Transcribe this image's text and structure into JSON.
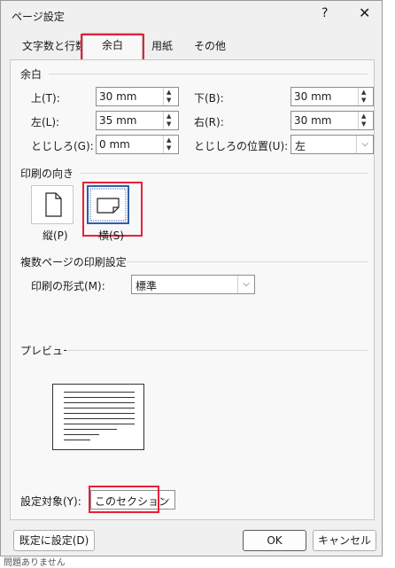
{
  "window": {
    "title": "ページ設定",
    "help": "?",
    "close": "✕"
  },
  "tabs": [
    {
      "label": "文字数と行数"
    },
    {
      "label": "余白"
    },
    {
      "label": "用紙"
    },
    {
      "label": "その他"
    }
  ],
  "margins": {
    "heading": "余白",
    "top_label": "上(T):",
    "top_value": "30 mm",
    "bottom_label": "下(B):",
    "bottom_value": "30 mm",
    "left_label": "左(L):",
    "left_value": "35 mm",
    "right_label": "右(R):",
    "right_value": "30 mm",
    "gutter_label": "とじしろ(G):",
    "gutter_value": "0 mm",
    "gutter_pos_label": "とじしろの位置(U):",
    "gutter_pos_value": "左"
  },
  "orientation": {
    "heading": "印刷の向き",
    "portrait_label": "縦(P)",
    "landscape_label": "横(S)",
    "selected": "横(S)"
  },
  "pages": {
    "heading": "複数ページの印刷設定",
    "format_label": "印刷の形式(M):",
    "format_value": "標準"
  },
  "preview": {
    "heading": "プレビュー"
  },
  "apply": {
    "label": "設定対象(Y):",
    "value": "このセクション"
  },
  "footer": {
    "default_button": "既定に設定(D)",
    "ok_button": "OK",
    "cancel_button": "キャンセル"
  },
  "background_text": {
    "bottom": "問題ありません"
  }
}
